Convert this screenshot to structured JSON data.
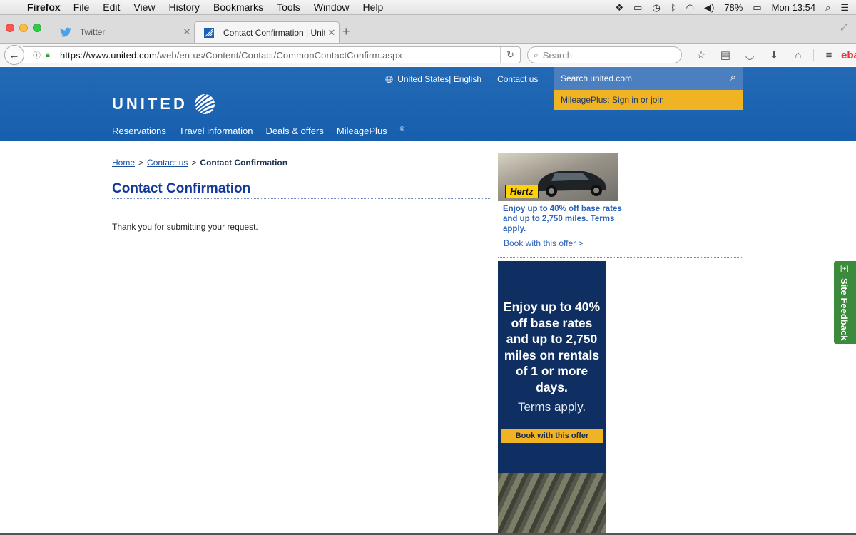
{
  "menubar": {
    "app_name": "Firefox",
    "menus": [
      "File",
      "Edit",
      "View",
      "History",
      "Bookmarks",
      "Tools",
      "Window",
      "Help"
    ],
    "battery": "78%",
    "clock": "Mon 13:54"
  },
  "tabs": [
    {
      "title": "Twitter",
      "icon": "twitter-bird-icon",
      "active": false
    },
    {
      "title": "Contact Confirmation | Unite",
      "icon": "united-favicon",
      "active": true
    }
  ],
  "navbar": {
    "url_host": "https://www.united.com",
    "url_path": "/web/en-us/Content/Contact/CommonContactConfirm.aspx",
    "search_placeholder": "Search",
    "ebay_label": "ebay"
  },
  "site_header": {
    "locale": "United States| English",
    "contact_link": "Contact us",
    "search_label": "Search united.com",
    "mileageplus_cta": "MileagePlus: Sign in or join",
    "logo_text": "UNITED",
    "nav": [
      "Reservations",
      "Travel information",
      "Deals & offers",
      "MileagePlus"
    ],
    "nav_registered": "®"
  },
  "content": {
    "breadcrumb": {
      "home": "Home",
      "contact": "Contact us",
      "current": "Contact Confirmation",
      "separator": ">"
    },
    "title": "Contact Confirmation",
    "message": "Thank you for submitting your request."
  },
  "ads": {
    "hertz_logo": "Hertz",
    "hertz_text": "Enjoy up to 40% off base rates and up to 2,750 miles. Terms apply.",
    "hertz_link": "Book with this offer >",
    "banner_headline": "Enjoy up to 40% off base rates and up to 2,750 miles on rentals of 1 or more days.",
    "banner_terms": "Terms apply.",
    "banner_button": "Book with this offer"
  },
  "feedback": {
    "plus": "[+]",
    "label": "Site Feedback"
  },
  "colors": {
    "united_blue": "#175fae",
    "mileageplus_gold": "#f0b323",
    "banner_navy": "#0f2f62",
    "feedback_green": "#3c8a3c"
  }
}
